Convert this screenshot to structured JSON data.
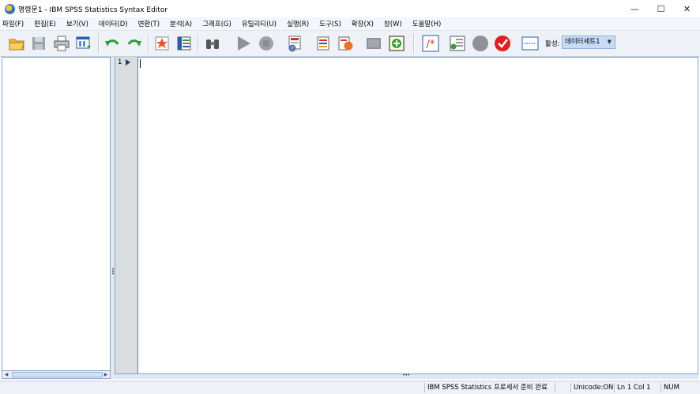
{
  "window": {
    "title": "명령문1 - IBM SPSS Statistics Syntax Editor",
    "controls": [
      "minimize",
      "maximize",
      "close"
    ]
  },
  "menu": [
    "파일(F)",
    "편집(E)",
    "보기(V)",
    "데이터(D)",
    "변환(T)",
    "분석(A)",
    "그래프(G)",
    "유틸리티(U)",
    "실행(R)",
    "도구(S)",
    "확장(X)",
    "창(W)",
    "도움말(H)"
  ],
  "toolbar": {
    "icons": [
      "open-folder-icon",
      "save-icon",
      "print-icon",
      "recall-dialog-icon",
      "undo-icon",
      "redo-icon",
      "goto-case-icon",
      "variables-icon",
      "find-icon",
      "run-icon",
      "stop-icon",
      "syntax-help-icon",
      "bookmark-icon",
      "toggle-bookmark-icon",
      "block-comment-icon",
      "add-icon",
      "comment-icon",
      "format-icon",
      "breakpoint-icon",
      "validate-icon",
      "line-icon"
    ],
    "active_label": "활성:",
    "active_dataset": "데이터세트1"
  },
  "editor": {
    "line_numbers": [
      "1"
    ],
    "content": ""
  },
  "status": {
    "processor": "IBM SPSS Statistics 프로세서 준비 완료",
    "unicode": "Unicode:ON",
    "position": "Ln 1 Col 1",
    "numlock": "NUM"
  },
  "colors": {
    "accent": "#4d86c9",
    "menubar_bg": "#f3f6fb",
    "toolbar_bg": "#eef1f6",
    "gutter_bg": "#d9dde2",
    "active_select_bg": "#c6dcf5"
  }
}
